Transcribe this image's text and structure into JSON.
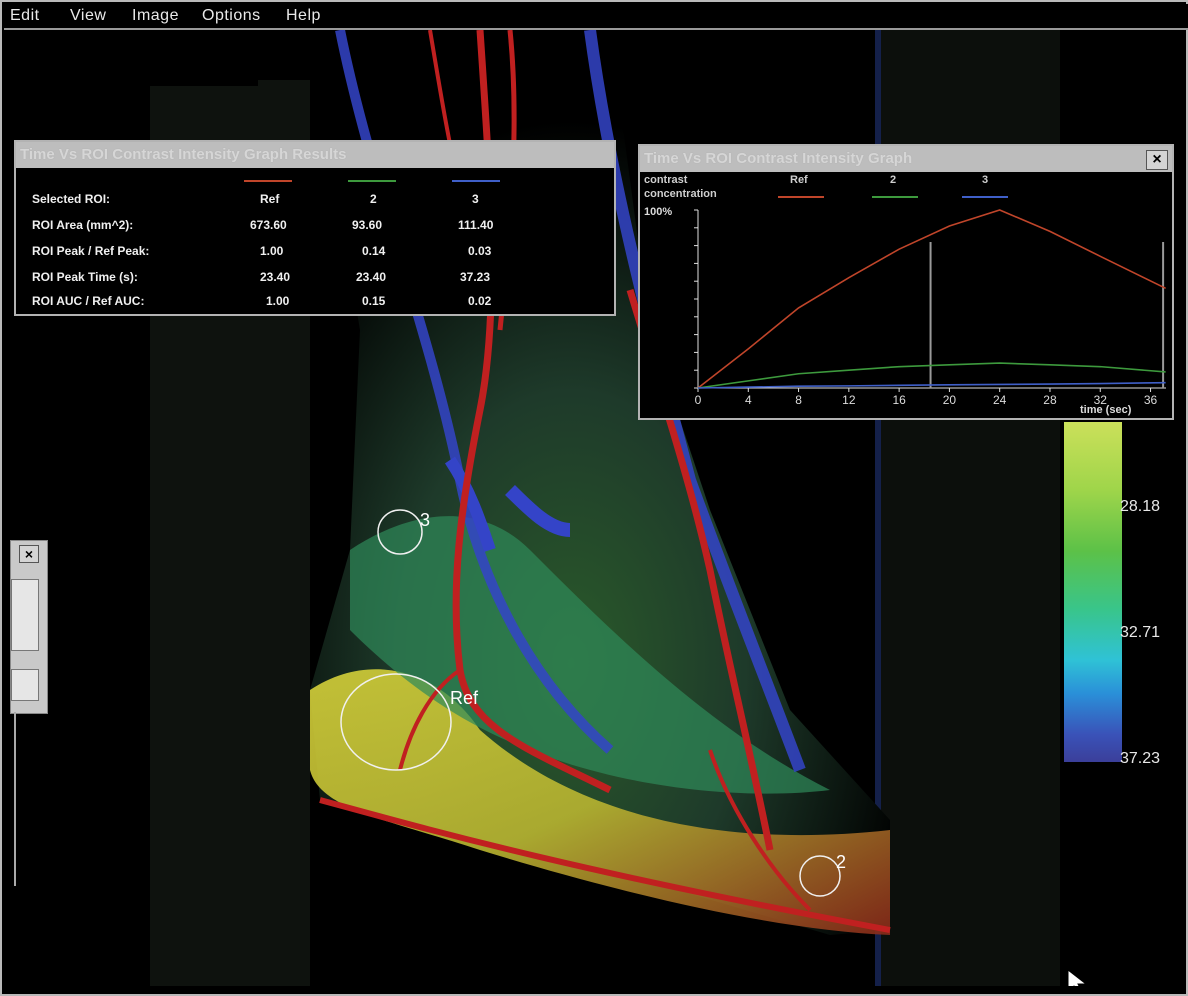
{
  "menu": [
    "Edit",
    "View",
    "Image",
    "Options",
    "Help"
  ],
  "results_panel": {
    "title": "Time Vs ROI Contrast Intensity Graph Results",
    "columns": [
      "Ref",
      "2",
      "3"
    ],
    "rows": [
      {
        "label": "Selected ROI:",
        "values": [
          "Ref",
          "2",
          "3"
        ]
      },
      {
        "label": "ROI Area (mm^2):",
        "values": [
          "673.60",
          "93.60",
          "111.40"
        ]
      },
      {
        "label": "ROI Peak / Ref Peak:",
        "values": [
          "1.00",
          "0.14",
          "0.03"
        ]
      },
      {
        "label": "ROI Peak Time (s):",
        "values": [
          "23.40",
          "23.40",
          "37.23"
        ]
      },
      {
        "label": "ROI AUC / Ref AUC:",
        "values": [
          "1.00",
          "0.15",
          "0.02"
        ]
      }
    ],
    "series_colors": [
      "#c0452a",
      "#3d9a3d",
      "#3f5fc8"
    ]
  },
  "graph_panel": {
    "title": "Time Vs ROI Contrast Intensity Graph",
    "close_label": "×",
    "legend_label_1": "contrast",
    "legend_label_2": "concentration",
    "legend_series": [
      "Ref",
      "2",
      "3"
    ],
    "y_top_label": "100%",
    "x_label": "time (sec)",
    "x_ticks": [
      "0",
      "4",
      "8",
      "12",
      "16",
      "20",
      "24",
      "28",
      "32",
      "36"
    ]
  },
  "chart_data": {
    "type": "line",
    "ylim": [
      0,
      100
    ],
    "xlim": [
      0,
      37.23
    ],
    "x": [
      0,
      4,
      8,
      12,
      16,
      20,
      24,
      28,
      32,
      37.2
    ],
    "series": [
      {
        "name": "Ref",
        "color": "#c0452a",
        "values": [
          0,
          22,
          45,
          62,
          78,
          91,
          100,
          88,
          74,
          56
        ]
      },
      {
        "name": "2",
        "color": "#3d9a3d",
        "values": [
          0,
          4,
          8,
          10,
          12,
          13,
          14,
          13,
          12,
          9
        ]
      },
      {
        "name": "3",
        "color": "#3f5fc8",
        "values": [
          0,
          0.5,
          1,
          1.2,
          1.5,
          1.8,
          2,
          2.2,
          2.5,
          3
        ]
      }
    ]
  },
  "colorbar": {
    "labels": [
      "28.18",
      "32.71",
      "37.23"
    ]
  },
  "rois": [
    {
      "label": "3"
    },
    {
      "label": "Ref"
    },
    {
      "label": "2"
    }
  ],
  "side_panel": {
    "close_label": "×"
  }
}
